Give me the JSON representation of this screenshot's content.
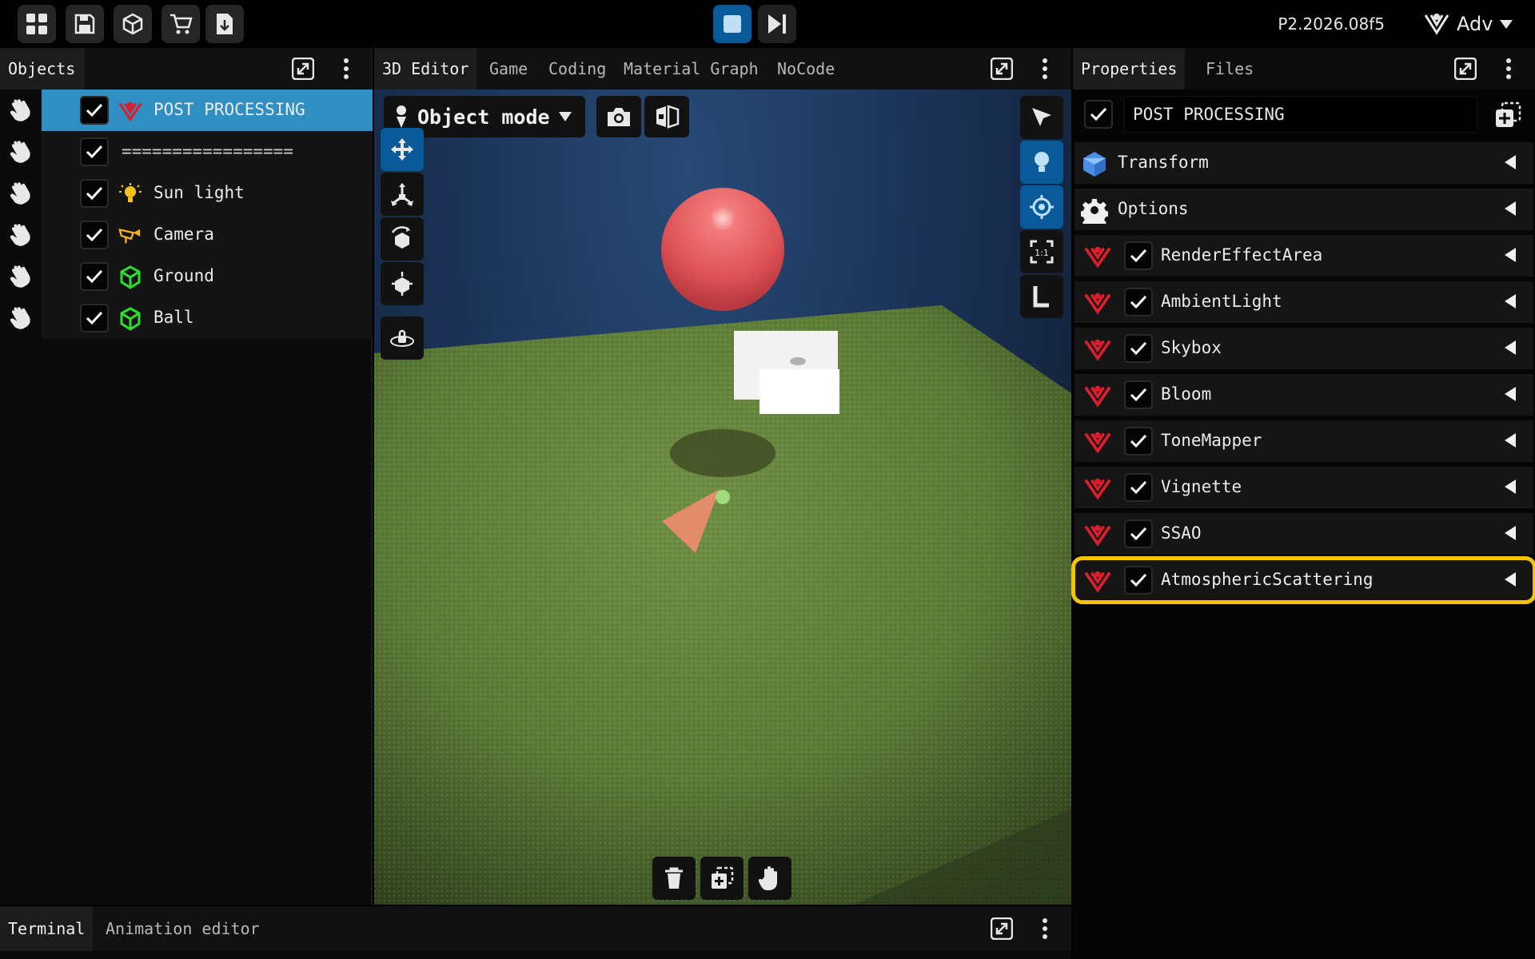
{
  "topbar": {
    "left_buttons": [
      "grid-icon",
      "save-icon",
      "cube-icon",
      "cart-icon",
      "download-icon"
    ],
    "version": "P2.2026.08f5",
    "profile_label": "Adv"
  },
  "objects_panel": {
    "tab": "Objects",
    "items": [
      {
        "label": "POST PROCESSING",
        "checked": true,
        "icon": "post-processing-icon",
        "selected": true
      },
      {
        "label": "=================",
        "checked": true,
        "icon": "",
        "selected": false
      },
      {
        "label": "Sun light",
        "checked": true,
        "icon": "light-bulb-icon",
        "selected": false
      },
      {
        "label": "Camera",
        "checked": true,
        "icon": "camera-object-icon",
        "selected": false
      },
      {
        "label": "Ground",
        "checked": true,
        "icon": "mesh-icon",
        "selected": false
      },
      {
        "label": "Ball",
        "checked": true,
        "icon": "mesh-icon",
        "selected": false
      }
    ]
  },
  "editor": {
    "tabs": [
      "3D Editor",
      "Game",
      "Coding",
      "Material Graph",
      "NoCode"
    ],
    "active_tab": "3D Editor",
    "mode": "Object mode"
  },
  "properties": {
    "tabs": [
      "Properties",
      "Files"
    ],
    "active_tab": "Properties",
    "name_value": "POST PROCESSING",
    "sections": [
      {
        "label": "Transform",
        "icon": "cube-icon"
      },
      {
        "label": "Options",
        "icon": "gear-icon"
      }
    ],
    "components": [
      {
        "label": "RenderEffectArea",
        "checked": true,
        "highlight": false
      },
      {
        "label": "AmbientLight",
        "checked": true,
        "highlight": false
      },
      {
        "label": "Skybox",
        "checked": true,
        "highlight": false
      },
      {
        "label": "Bloom",
        "checked": true,
        "highlight": false
      },
      {
        "label": "ToneMapper",
        "checked": true,
        "highlight": false
      },
      {
        "label": "Vignette",
        "checked": true,
        "highlight": false
      },
      {
        "label": "SSAO",
        "checked": true,
        "highlight": false
      },
      {
        "label": "AtmosphericScattering",
        "checked": true,
        "highlight": true
      }
    ]
  },
  "terminal": {
    "tabs": [
      "Terminal",
      "Animation editor"
    ],
    "active_tab": "Terminal"
  },
  "colors": {
    "accent": "#0a5a9a",
    "selection": "#2f8ec2",
    "highlight": "#f5c400",
    "post_icon": "#d8202c"
  }
}
